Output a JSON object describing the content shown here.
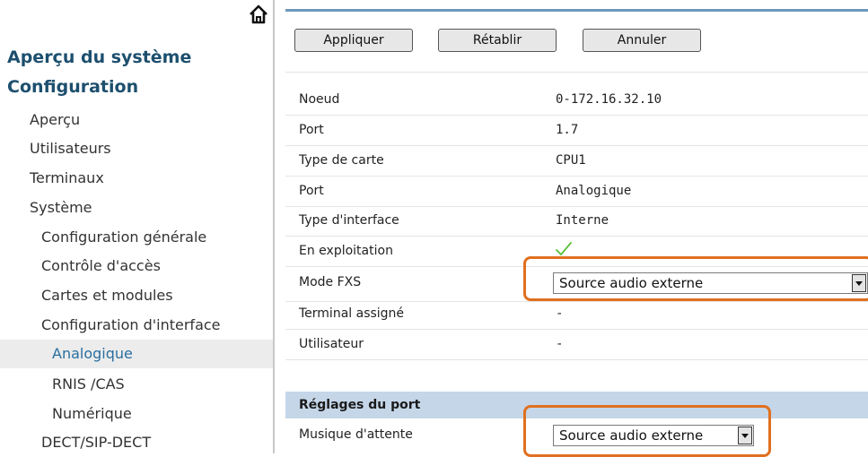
{
  "sidebar": {
    "home_icon": "home-icon",
    "heading1": "Aperçu du système",
    "heading2": "Configuration",
    "items": [
      {
        "label": "Aperçu",
        "level": 0
      },
      {
        "label": "Utilisateurs",
        "level": 0
      },
      {
        "label": "Terminaux",
        "level": 0
      },
      {
        "label": "Système",
        "level": 0
      },
      {
        "label": "Configuration générale",
        "level": 1
      },
      {
        "label": "Contrôle d'accès",
        "level": 1
      },
      {
        "label": "Cartes et modules",
        "level": 1
      },
      {
        "label": "Configuration d'interface",
        "level": 1
      },
      {
        "label": "Analogique",
        "level": 2,
        "active": true
      },
      {
        "label": "RNIS /CAS",
        "level": 2
      },
      {
        "label": "Numérique",
        "level": 2
      },
      {
        "label": "DECT/SIP-DECT",
        "level": 1
      }
    ]
  },
  "toolbar": {
    "apply_label": "Appliquer",
    "reset_label": "Rétablir",
    "cancel_label": "Annuler"
  },
  "properties": [
    {
      "label": "Noeud",
      "value": "0-172.16.32.10"
    },
    {
      "label": "Port",
      "value": "1.7"
    },
    {
      "label": "Type de carte",
      "value": "CPU1"
    },
    {
      "label": "Port",
      "value": "Analogique"
    },
    {
      "label": "Type d'interface",
      "value": "Interne"
    },
    {
      "label": "En exploitation",
      "value_icon": "checkmark-icon"
    },
    {
      "label": "Mode FXS",
      "select_value": "Source audio externe"
    },
    {
      "label": "Terminal assigné",
      "value": "-"
    },
    {
      "label": "Utilisateur",
      "value": "-"
    }
  ],
  "port_settings": {
    "title": "Réglages du port",
    "hold_music_label": "Musique d'attente",
    "hold_music_value": "Source audio externe"
  },
  "colors": {
    "highlight": "#e07020",
    "section_bg": "#c5d6e8",
    "sidebar_heading": "#1d4f6e",
    "active_item": "#2a6fa0"
  }
}
